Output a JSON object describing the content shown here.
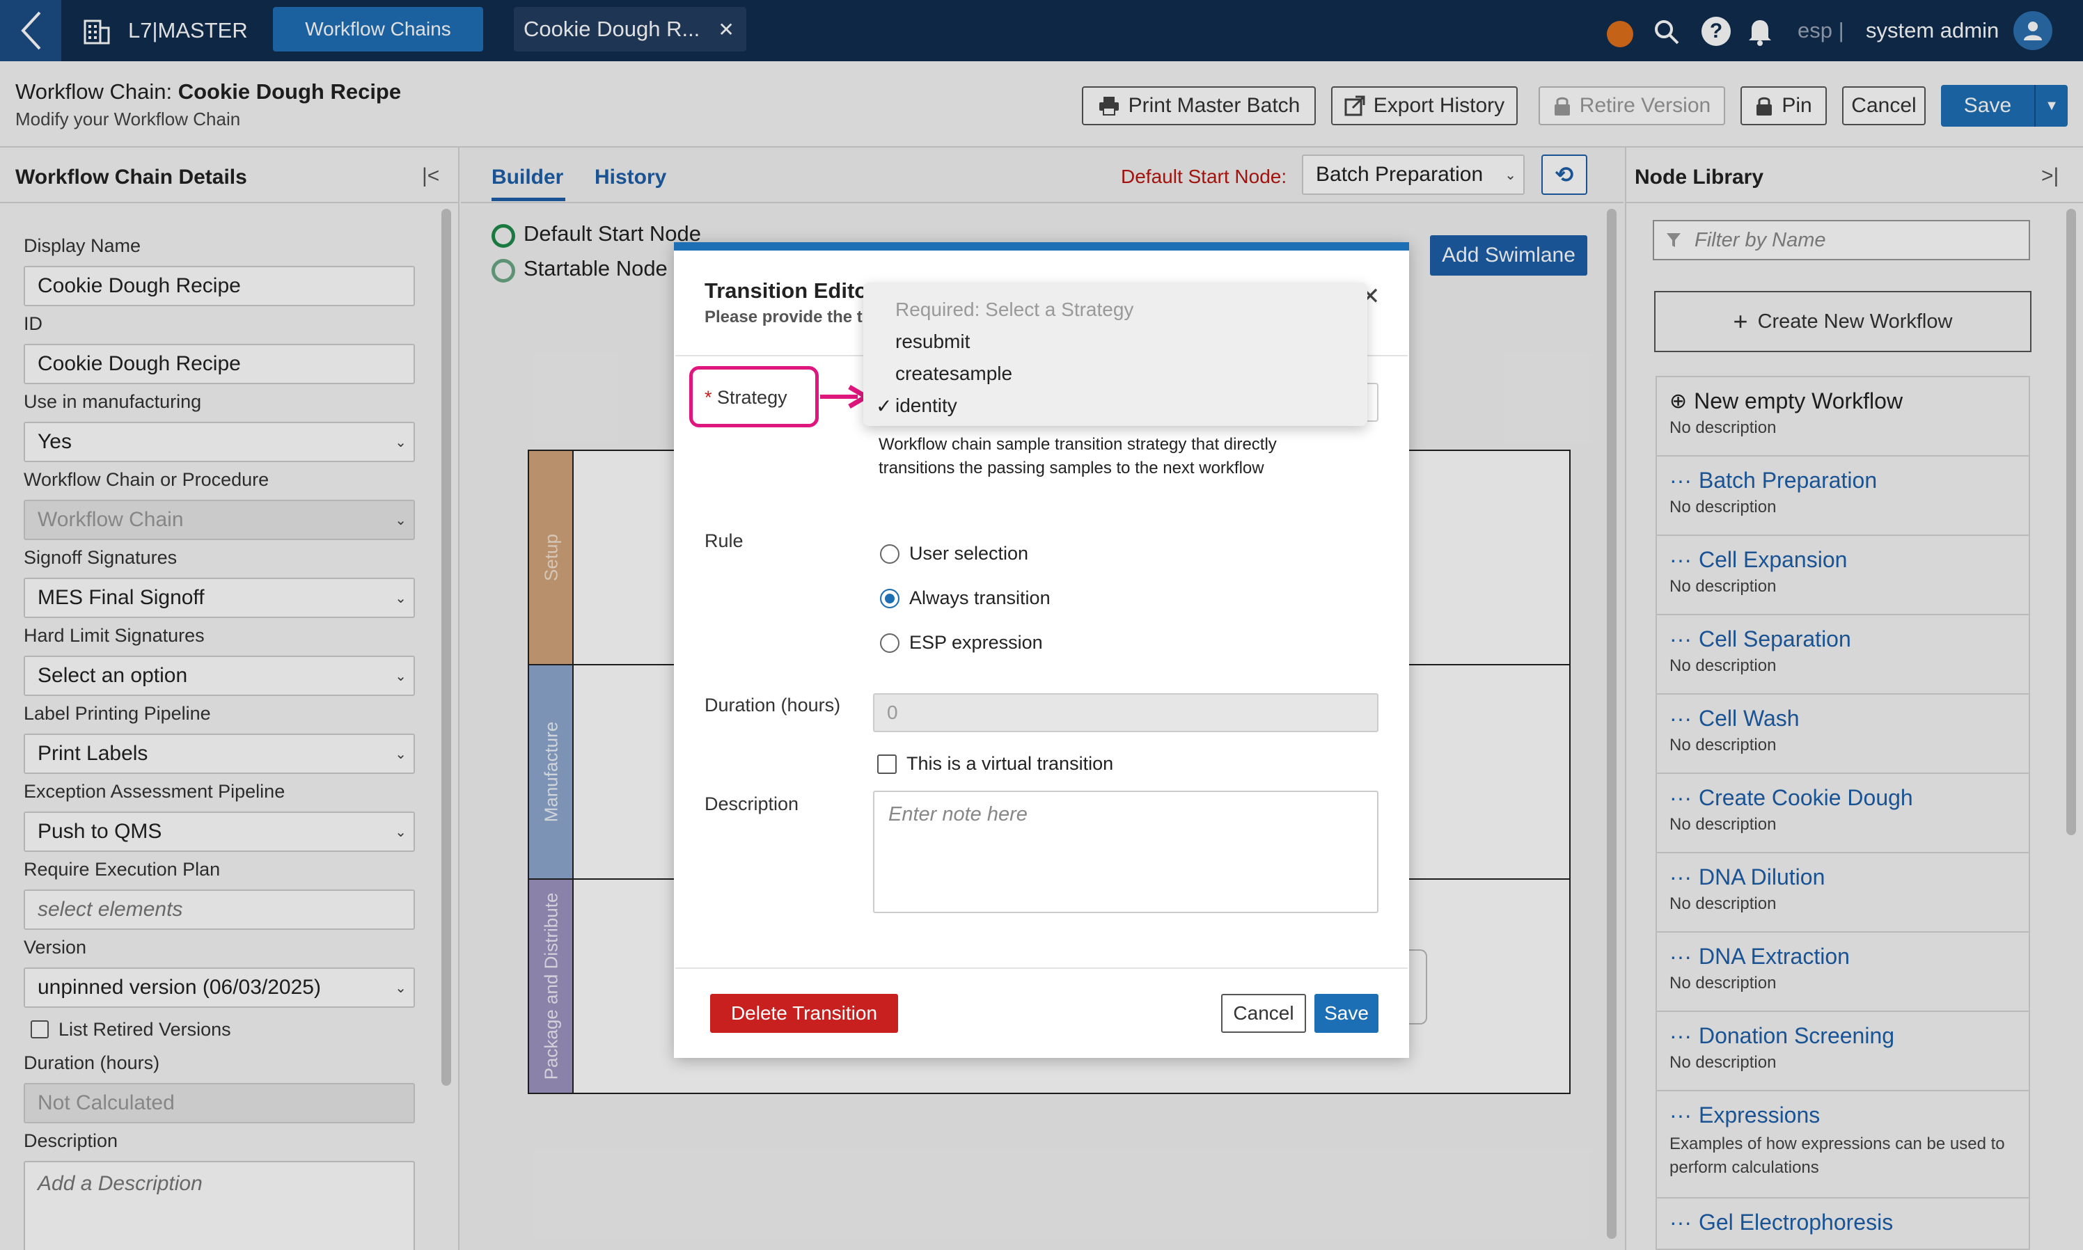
{
  "topbar": {
    "brand": "L7|MASTER",
    "workflow_chains_tab": "Workflow Chains",
    "open_tab": "Cookie Dough R...",
    "lang": "esp",
    "user": "system admin"
  },
  "header": {
    "title_prefix": "Workflow Chain: ",
    "title_name": "Cookie Dough Recipe",
    "subtitle": "Modify your Workflow Chain",
    "buttons": {
      "print": "Print Master Batch",
      "export": "Export History",
      "retire": "Retire Version",
      "pin": "Pin",
      "cancel": "Cancel",
      "save": "Save"
    }
  },
  "left_panel": {
    "title": "Workflow Chain Details",
    "fields": {
      "display_name_label": "Display Name",
      "display_name": "Cookie Dough Recipe",
      "id_label": "ID",
      "id": "Cookie Dough Recipe",
      "manufacturing_label": "Use in manufacturing",
      "manufacturing": "Yes",
      "chain_or_proc_label": "Workflow Chain or Procedure",
      "chain_or_proc": "Workflow Chain",
      "signoff_label": "Signoff Signatures",
      "signoff": "MES Final Signoff",
      "hard_limit_label": "Hard Limit Signatures",
      "hard_limit": "Select an option",
      "label_printing_label": "Label Printing Pipeline",
      "label_printing": "Print Labels",
      "exception_label": "Exception Assessment Pipeline",
      "exception": "Push to QMS",
      "exec_plan_label": "Require Execution Plan",
      "exec_plan_placeholder": "select elements",
      "version_label": "Version",
      "version": "unpinned version (06/03/2025)",
      "list_retired": "List Retired Versions",
      "duration_label": "Duration (hours)",
      "duration": "Not Calculated",
      "description_label": "Description",
      "description_placeholder": "Add a Description"
    }
  },
  "center": {
    "tabs": [
      "Builder",
      "History"
    ],
    "default_start_label": "Default Start Node:",
    "default_start_value": "Batch Preparation",
    "legend_default": "Default Start Node",
    "legend_startable": "Startable Node",
    "add_swimlane": "Add Swimlane",
    "swimlanes": [
      "Setup",
      "Manufacture",
      "Package and Distribute"
    ]
  },
  "right_panel": {
    "title": "Node Library",
    "filter_placeholder": "Filter by Name",
    "create_new": "Create New Workflow",
    "items": [
      {
        "title": "New empty Workflow",
        "desc": "No description"
      },
      {
        "title": "Batch Preparation",
        "desc": "No description"
      },
      {
        "title": "Cell Expansion",
        "desc": "No description"
      },
      {
        "title": "Cell Separation",
        "desc": "No description"
      },
      {
        "title": "Cell Wash",
        "desc": "No description"
      },
      {
        "title": "Create Cookie Dough",
        "desc": "No description"
      },
      {
        "title": "DNA Dilution",
        "desc": "No description"
      },
      {
        "title": "DNA Extraction",
        "desc": "No description"
      },
      {
        "title": "Donation Screening",
        "desc": "No description"
      },
      {
        "title": "Expressions",
        "desc": "Examples of how expressions can be used to perform calculations"
      },
      {
        "title": "Gel Electrophoresis",
        "desc": ""
      }
    ]
  },
  "modal": {
    "title": "Transition Edito",
    "subtitle": "Please provide the t",
    "strategy_label": "Strategy",
    "strategy_required_mark": "*",
    "strategy_help": "Workflow chain sample transition strategy that directly transitions the passing samples to the next workflow",
    "rule_label": "Rule",
    "rule_options": [
      "User selection",
      "Always transition",
      "ESP expression"
    ],
    "rule_selected": "Always transition",
    "duration_label": "Duration (hours)",
    "duration_value": "0",
    "virtual_label": "This is a virtual transition",
    "description_label": "Description",
    "description_placeholder": "Enter note here",
    "delete_button": "Delete Transition",
    "cancel_button": "Cancel",
    "save_button": "Save"
  },
  "dropdown": {
    "placeholder": "Required: Select a Strategy",
    "options": [
      "resubmit",
      "createsample",
      "identity"
    ],
    "selected": "identity",
    "check": "✓"
  },
  "colors": {
    "topbar": "#0f2d4f",
    "primary": "#1d6fb5",
    "danger": "#c8201f",
    "highlight": "#e0167f",
    "lane_setup": "#d2a47a",
    "lane_manufacture": "#8fa8cf",
    "lane_package": "#9e95c1"
  }
}
